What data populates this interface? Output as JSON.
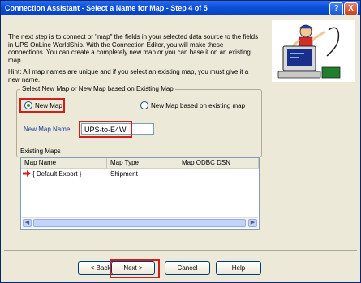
{
  "window": {
    "title": "Connection Assistant - Select a Name for Map - Step 4 of 5",
    "help_glyph": "?",
    "close_glyph": "X"
  },
  "intro_text": "The next step is to connect or \"map\" the fields in your selected data source to the fields in UPS OnLine WorldShip. With the Connection Editor, you will make these connections. You can create a completely new map or you can base it on an existing map.",
  "hint_text": "Hint: All map names are unique and if you select an existing map, you must give it a new name.",
  "group": {
    "legend": "Select New Map or New Map based on Existing Map",
    "option_new": "New Map",
    "option_existing": "New Map based on existing map",
    "selected": "New Map",
    "map_name_label": "New Map Name:",
    "map_name_value": "UPS-to-E4W"
  },
  "existing_maps": {
    "label": "Existing Maps",
    "columns": [
      "Map Name",
      "Map Type",
      "Map ODBC DSN"
    ],
    "rows": [
      {
        "name": "{ Default Export }",
        "type": "Shipment",
        "dsn": ""
      }
    ]
  },
  "buttons": {
    "back": "< Back",
    "next": "Next >",
    "cancel": "Cancel",
    "help": "Help"
  },
  "colors": {
    "title_bar": "#0a4fd8",
    "highlight": "#d0201c",
    "field_label": "#1c3f9a"
  },
  "icons": [
    "help-icon",
    "close-icon",
    "connection-assistant-illustration",
    "selected-row-arrow-icon",
    "scroll-left-icon",
    "scroll-right-icon"
  ]
}
